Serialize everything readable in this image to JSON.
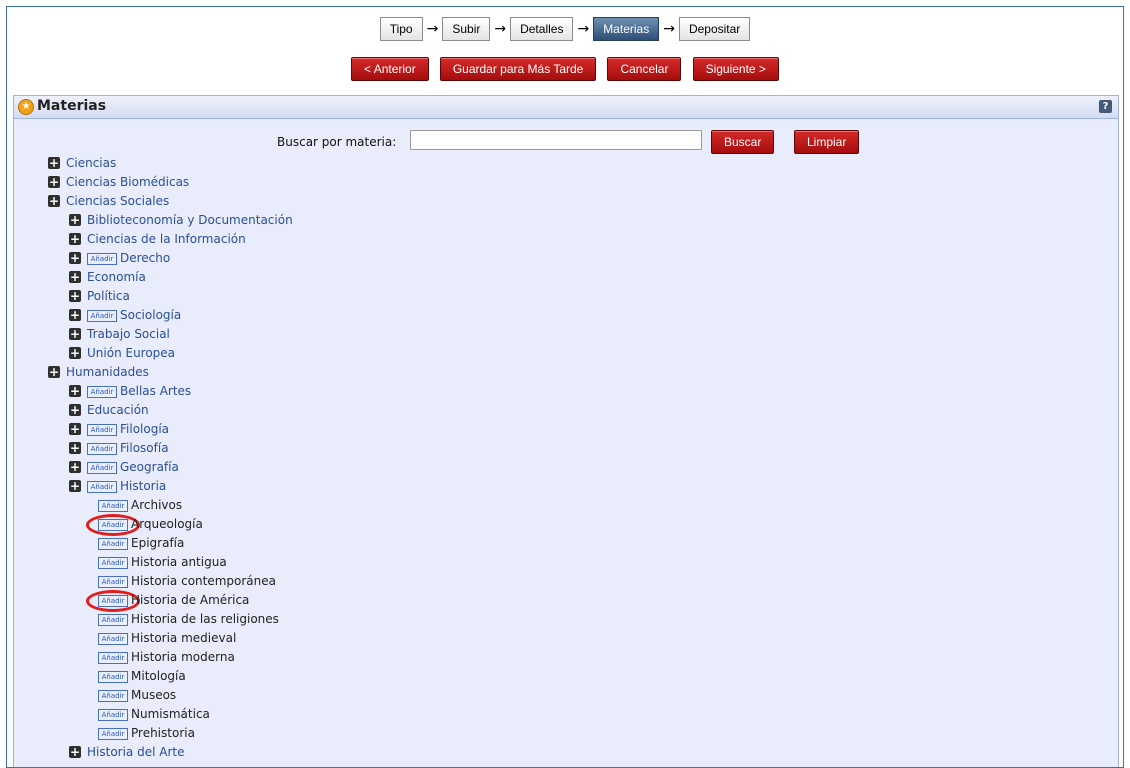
{
  "steps": [
    {
      "label": "Tipo",
      "active": false
    },
    {
      "label": "Subir",
      "active": false
    },
    {
      "label": "Detalles",
      "active": false
    },
    {
      "label": "Materias",
      "active": true
    },
    {
      "label": "Depositar",
      "active": false
    }
  ],
  "actions": {
    "prev": "< Anterior",
    "save": "Guardar para Más Tarde",
    "cancel": "Cancelar",
    "next": "Siguiente >"
  },
  "panel": {
    "title": "Materias",
    "help": "?"
  },
  "search": {
    "label": "Buscar por materia:",
    "value": "",
    "search_btn": "Buscar",
    "clear_btn": "Limpiar"
  },
  "add_label": "Añadir",
  "tree": [
    {
      "label": "Ciencias",
      "level": 0,
      "expand": true,
      "add": false
    },
    {
      "label": "Ciencias Biomédicas",
      "level": 0,
      "expand": true,
      "add": false
    },
    {
      "label": "Ciencias Sociales",
      "level": 0,
      "expand": true,
      "add": false
    },
    {
      "label": "Biblioteconomía y Documentación",
      "level": 1,
      "expand": true,
      "add": false
    },
    {
      "label": "Ciencias de la Información",
      "level": 1,
      "expand": true,
      "add": false
    },
    {
      "label": "Derecho",
      "level": 1,
      "expand": true,
      "add": true
    },
    {
      "label": "Economía",
      "level": 1,
      "expand": true,
      "add": false
    },
    {
      "label": "Política",
      "level": 1,
      "expand": true,
      "add": false
    },
    {
      "label": "Sociología",
      "level": 1,
      "expand": true,
      "add": true
    },
    {
      "label": "Trabajo Social",
      "level": 1,
      "expand": true,
      "add": false
    },
    {
      "label": "Unión Europea",
      "level": 1,
      "expand": true,
      "add": false
    },
    {
      "label": "Humanidades",
      "level": 0,
      "expand": true,
      "add": false
    },
    {
      "label": "Bellas Artes",
      "level": 1,
      "expand": true,
      "add": true
    },
    {
      "label": "Educación",
      "level": 1,
      "expand": true,
      "add": false
    },
    {
      "label": "Filología",
      "level": 1,
      "expand": true,
      "add": true
    },
    {
      "label": "Filosofía",
      "level": 1,
      "expand": true,
      "add": true
    },
    {
      "label": "Geografía",
      "level": 1,
      "expand": true,
      "add": true
    },
    {
      "label": "Historia",
      "level": 1,
      "expand": true,
      "add": true
    },
    {
      "label": "Archivos",
      "level": 2,
      "expand": false,
      "add": true
    },
    {
      "label": "Arqueología",
      "level": 2,
      "expand": false,
      "add": true,
      "highlight": true
    },
    {
      "label": "Epigrafía",
      "level": 2,
      "expand": false,
      "add": true
    },
    {
      "label": "Historia antigua",
      "level": 2,
      "expand": false,
      "add": true
    },
    {
      "label": "Historia contemporánea",
      "level": 2,
      "expand": false,
      "add": true
    },
    {
      "label": "Historia de América",
      "level": 2,
      "expand": false,
      "add": true,
      "highlight": true
    },
    {
      "label": "Historia de las religiones",
      "level": 2,
      "expand": false,
      "add": true
    },
    {
      "label": "Historia medieval",
      "level": 2,
      "expand": false,
      "add": true
    },
    {
      "label": "Historia moderna",
      "level": 2,
      "expand": false,
      "add": true
    },
    {
      "label": "Mitología",
      "level": 2,
      "expand": false,
      "add": true
    },
    {
      "label": "Museos",
      "level": 2,
      "expand": false,
      "add": true
    },
    {
      "label": "Numismática",
      "level": 2,
      "expand": false,
      "add": true
    },
    {
      "label": "Prehistoria",
      "level": 2,
      "expand": false,
      "add": true
    },
    {
      "label": "Historia del Arte",
      "level": 1,
      "expand": true,
      "add": false
    }
  ],
  "colors": {
    "accent": "#2d4f76",
    "button": "#b81818",
    "link": "#2a4f98",
    "highlight_ring": "#e31c1c"
  }
}
